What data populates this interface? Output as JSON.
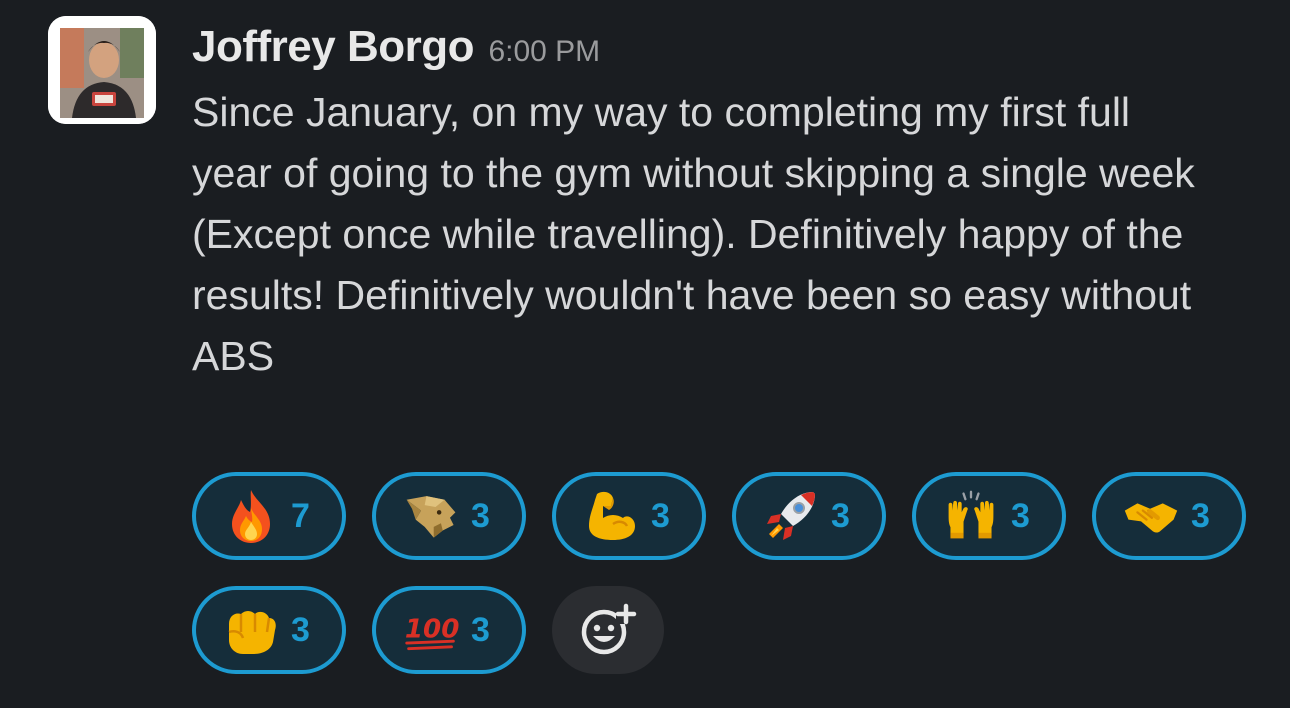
{
  "message": {
    "author": "Joffrey Borgo",
    "time": "6:00 PM",
    "text": "Since January, on my way to completing my first full year of going to the gym without skipping a single week (Except once while travelling). Definitively happy of the results! Definitively wouldn't have been so easy without ABS"
  },
  "reactions": [
    {
      "icon": "fire-emoji",
      "count": "7"
    },
    {
      "icon": "lion-logo-emoji",
      "count": "3"
    },
    {
      "icon": "flexed-biceps-emoji",
      "count": "3"
    },
    {
      "icon": "rocket-emoji",
      "count": "3"
    },
    {
      "icon": "raising-hands-emoji",
      "count": "3"
    },
    {
      "icon": "handshake-emoji",
      "count": "3"
    },
    {
      "icon": "oncoming-fist-emoji",
      "count": "3"
    },
    {
      "icon": "hundred-points-emoji",
      "count": "3"
    }
  ],
  "add_reaction": {
    "icon": "add-reaction-icon"
  },
  "colors": {
    "background": "#1a1d21",
    "reaction_border": "#1d9bd1",
    "reaction_count": "#1d9bd1"
  }
}
